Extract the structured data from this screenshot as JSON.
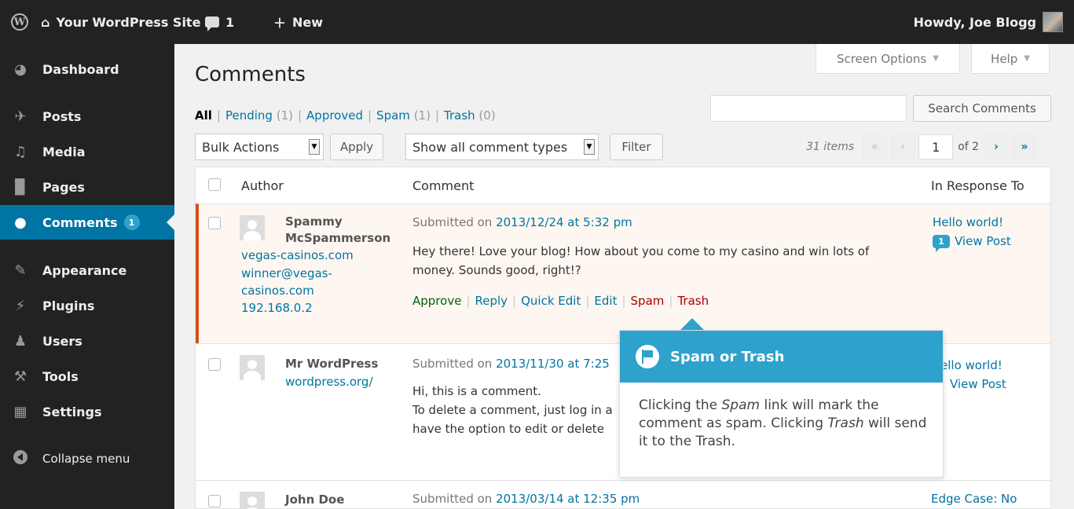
{
  "adminbar": {
    "site_name": "Your WordPress Site",
    "comment_count": "1",
    "new_label": "New",
    "howdy": "Howdy, Joe Blogg"
  },
  "sidebar": {
    "items": [
      {
        "label": "Dashboard",
        "icon": "dashboard-icon"
      },
      {
        "label": "Posts",
        "icon": "pin-icon"
      },
      {
        "label": "Media",
        "icon": "media-icon"
      },
      {
        "label": "Pages",
        "icon": "pages-icon"
      },
      {
        "label": "Comments",
        "icon": "comment-icon",
        "badge": "1",
        "active": true
      },
      {
        "label": "Appearance",
        "icon": "brush-icon"
      },
      {
        "label": "Plugins",
        "icon": "plug-icon"
      },
      {
        "label": "Users",
        "icon": "users-icon"
      },
      {
        "label": "Tools",
        "icon": "wrench-icon"
      },
      {
        "label": "Settings",
        "icon": "settings-icon"
      }
    ],
    "collapse_label": "Collapse menu"
  },
  "screen_options": "Screen Options",
  "help": "Help",
  "page_title": "Comments",
  "filters": {
    "all": "All",
    "pending": "Pending",
    "pending_count": "(1)",
    "approved": "Approved",
    "spam": "Spam",
    "spam_count": "(1)",
    "trash": "Trash",
    "trash_count": "(0)"
  },
  "search": {
    "button": "Search Comments",
    "value": ""
  },
  "bulk": {
    "selected": "Bulk Actions",
    "apply": "Apply"
  },
  "type_filter": {
    "selected": "Show all comment types",
    "filter": "Filter"
  },
  "pagination": {
    "items": "31 items",
    "first": "«",
    "prev": "‹",
    "current": "1",
    "of": "of 2",
    "next": "›",
    "last": "»"
  },
  "table": {
    "headers": {
      "author": "Author",
      "comment": "Comment",
      "response": "In Response To"
    },
    "rows": [
      {
        "author_line1": "Spammy",
        "author_line2": "McSpammerson",
        "url": "vegas-casinos.com",
        "email_line1": "winner@vegas-",
        "email_line2": "casinos.com",
        "ip": "192.168.0.2",
        "submitted_prefix": "Submitted on",
        "date": "2013/12/24 at 5:32 pm",
        "text_line1": "Hey there! Love your blog! How about you come to my casino and win lots of",
        "text_line2": "money. Sounds good, right!?",
        "actions": [
          "Approve",
          "Reply",
          "Quick Edit",
          "Edit",
          "Spam",
          "Trash"
        ],
        "response_title": "Hello world!",
        "response_count": "1",
        "view_post": "View Post"
      },
      {
        "author_line1": "Mr WordPress",
        "url": "wordpress.org/",
        "submitted_prefix": "Submitted on",
        "date": "2013/11/30 at 7:25",
        "text_line1": "Hi, this is a comment.",
        "text_line2": "To delete a comment, just log in a",
        "text_line3": "have the option to edit or delete",
        "response_title": "ello world!",
        "view_post": "View Post"
      },
      {
        "author_line1": "John Doe",
        "submitted_prefix": "Submitted on",
        "date": "2013/03/14 at 12:35 pm",
        "response_title": "Edge Case: No"
      }
    ]
  },
  "pointer": {
    "title": "Spam or Trash",
    "body_1": "Clicking the ",
    "body_em1": "Spam",
    "body_2": " link will mark the comment as spam. Clicking ",
    "body_em2": "Trash",
    "body_3": " will send it to the Trash."
  },
  "colors": {
    "accent": "#0074a2",
    "pointer": "#2ea2cc",
    "spam_border": "#d54e21",
    "approve": "#006505",
    "danger": "#aa0000"
  }
}
